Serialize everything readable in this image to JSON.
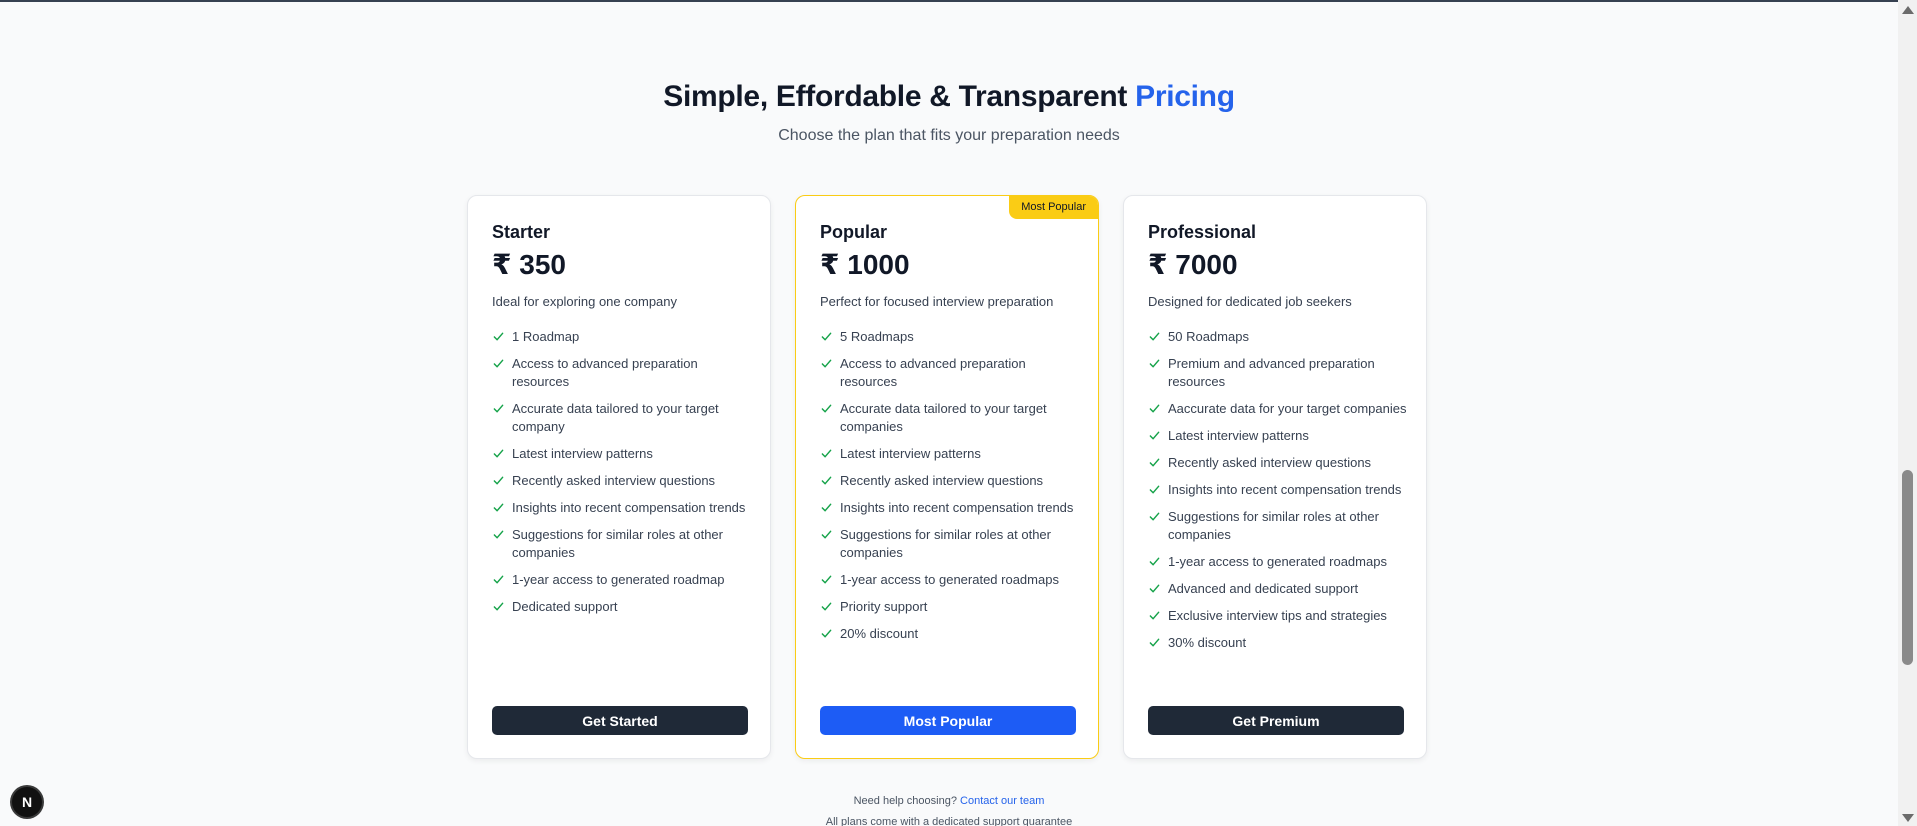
{
  "section": {
    "title_main": "Simple, Effordable & Transparent",
    "title_accent": "Pricing",
    "subtitle": "Choose the plan that fits your preparation needs",
    "accent_color": "#2563eb",
    "featured_border_color": "#facc15",
    "check_color": "#16a34a"
  },
  "plans": [
    {
      "name": "Starter",
      "price": "₹ 350",
      "description": "Ideal for exploring one company",
      "features": [
        "1 Roadmap",
        "Access to advanced preparation resources",
        "Accurate data tailored to your target company",
        "Latest interview patterns",
        "Recently asked interview questions",
        "Insights into recent compensation trends",
        "Suggestions for similar roles at other companies",
        "1-year access to generated roadmap",
        "Dedicated support"
      ],
      "cta": "Get Started"
    },
    {
      "name": "Popular",
      "badge": "Most Popular",
      "price": "₹ 1000",
      "description": "Perfect for focused interview preparation",
      "features": [
        "5 Roadmaps",
        "Access to advanced preparation resources",
        "Accurate data tailored to your target companies",
        "Latest interview patterns",
        "Recently asked interview questions",
        "Insights into recent compensation trends",
        "Suggestions for similar roles at other companies",
        "1-year access to generated roadmaps",
        "Priority support",
        "20% discount"
      ],
      "cta": "Most Popular"
    },
    {
      "name": "Professional",
      "price": "₹ 7000",
      "description": "Designed for dedicated job seekers",
      "features": [
        "50 Roadmaps",
        "Premium and advanced preparation resources",
        "Aaccurate data for your target companies",
        "Latest interview patterns",
        "Recently asked interview questions",
        "Insights into recent compensation trends",
        "Suggestions for similar roles at other companies",
        "1-year access to generated roadmaps",
        "Advanced and dedicated support",
        "Exclusive interview tips and strategies",
        "30% discount"
      ],
      "cta": "Get Premium"
    }
  ],
  "footer": {
    "help_text": "Need help choosing?",
    "contact_link": "Contact our team",
    "guarantee": "All plans come with a dedicated support guarantee"
  },
  "dev_badge": {
    "label": "N"
  }
}
